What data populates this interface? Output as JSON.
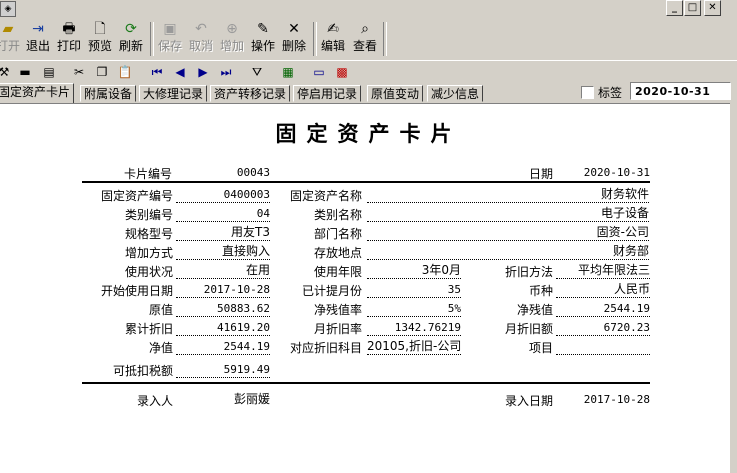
{
  "toolbar": {
    "open": "打开",
    "exit": "退出",
    "print": "打印",
    "preview": "预览",
    "refresh": "刷新",
    "save": "保存",
    "cancel": "取消",
    "add": "增加",
    "operate": "操作",
    "delete": "删除",
    "edit": "编辑",
    "view": "查看"
  },
  "tabs": [
    "固定资产卡片",
    "附属设备",
    "大修理记录",
    "资产转移记录",
    "停启用记录",
    "原值变动",
    "减少信息"
  ],
  "bookmark_label": "标签",
  "header_date": "2020-10-31",
  "card": {
    "title": "固定资产卡片",
    "card_no_label": "卡片编号",
    "card_no": "00043",
    "date_label": "日期",
    "date": "2020-10-31",
    "asset_no_label": "固定资产编号",
    "asset_no": "0400003",
    "asset_name_label": "固定资产名称",
    "asset_name": "财务软件",
    "category_no_label": "类别编号",
    "category_no": "04",
    "category_name_label": "类别名称",
    "category_name": "电子设备",
    "spec_label": "规格型号",
    "spec": "用友T3",
    "dept_label": "部门名称",
    "dept": "固资-公司",
    "add_method_label": "增加方式",
    "add_method": "直接购入",
    "location_label": "存放地点",
    "location": "财务部",
    "usage_label": "使用状况",
    "usage": "在用",
    "life_label": "使用年限",
    "life": "3年0月",
    "dep_method_label": "折旧方法",
    "dep_method": "平均年限法三",
    "start_date_label": "开始使用日期",
    "start_date": "2017-10-28",
    "months_label": "已计提月份",
    "months": "35",
    "currency_label": "币种",
    "currency": "人民币",
    "original_label": "原值",
    "original": "50883.62",
    "salvage_rate_label": "净残值率",
    "salvage_rate": "5%",
    "salvage_label": "净残值",
    "salvage": "2544.19",
    "accum_label": "累计折旧",
    "accum": "41619.20",
    "monthly_rate_label": "月折旧率",
    "monthly_rate": "1342.76219",
    "monthly_amt_label": "月折旧额",
    "monthly_amt": "6720.23",
    "net_label": "净值",
    "net": "2544.19",
    "account_label": "对应折旧科目",
    "account": "20105,折旧-公司",
    "project_label": "项目",
    "project": "",
    "tax_label": "可抵扣税额",
    "tax": "5919.49",
    "entered_by_label": "录入人",
    "entered_by": "彭丽媛",
    "entry_date_label": "录入日期",
    "entry_date": "2017-10-28"
  }
}
